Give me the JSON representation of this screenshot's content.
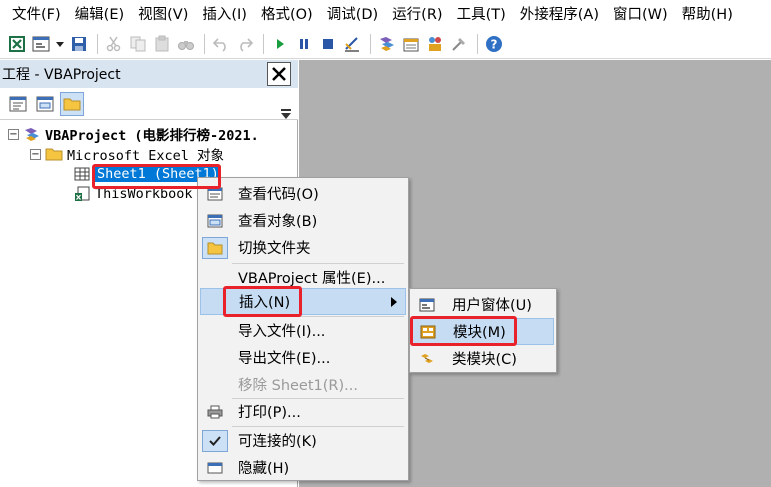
{
  "menubar": {
    "items": [
      "文件(F)",
      "编辑(E)",
      "视图(V)",
      "插入(I)",
      "格式(O)",
      "调试(D)",
      "运行(R)",
      "工具(T)",
      "外接程序(A)",
      "窗口(W)",
      "帮助(H)"
    ]
  },
  "toolbar": {
    "icons": [
      "excel-icon",
      "insert-userform-icon",
      "dropdown-arrow-icon",
      "save-icon",
      "cut-icon",
      "copy-icon",
      "paste-icon",
      "find-icon",
      "undo-icon",
      "redo-icon",
      "run-icon",
      "break-icon",
      "reset-icon",
      "design-mode-icon",
      "project-explorer-icon",
      "properties-window-icon",
      "object-browser-icon",
      "toolbox-icon",
      "help-icon"
    ]
  },
  "project_panel": {
    "title": "工程 - VBAProject",
    "close_glyph": "✕"
  },
  "tree": {
    "root_label": "VBAProject (电影排行榜-2021.",
    "folder_label": "Microsoft Excel 对象",
    "sheet_label": "Sheet1 (Sheet1)",
    "workbook_label": "ThisWorkbook",
    "expander_glyph": "−"
  },
  "context_menu": {
    "items": [
      {
        "label": "查看代码(O)",
        "icon": "view-code-icon"
      },
      {
        "label": "查看对象(B)",
        "icon": "view-object-icon"
      },
      {
        "label": "切换文件夹",
        "icon": "toggle-folders-icon"
      },
      {
        "label": "VBAProject 属性(E)...",
        "icon": ""
      },
      {
        "label": "插入(N)",
        "icon": ""
      },
      {
        "label": "导入文件(I)...",
        "icon": ""
      },
      {
        "label": "导出文件(E)...",
        "icon": ""
      },
      {
        "label": "移除 Sheet1(R)...",
        "icon": ""
      },
      {
        "label": "打印(P)...",
        "icon": "print-icon"
      },
      {
        "label": "可连接的(K)",
        "icon": "check-icon"
      },
      {
        "label": "隐藏(H)",
        "icon": "hide-icon"
      }
    ]
  },
  "submenu": {
    "items": [
      {
        "label": "用户窗体(U)",
        "icon": "userform-icon"
      },
      {
        "label": "模块(M)",
        "icon": "module-icon"
      },
      {
        "label": "类模块(C)",
        "icon": "class-module-icon"
      }
    ]
  },
  "colors": {
    "highlight": "#c5dcf3",
    "annotation_red": "#e8212a",
    "workspace_gray": "#b0b0b0",
    "selection_blue": "#0078d7"
  }
}
